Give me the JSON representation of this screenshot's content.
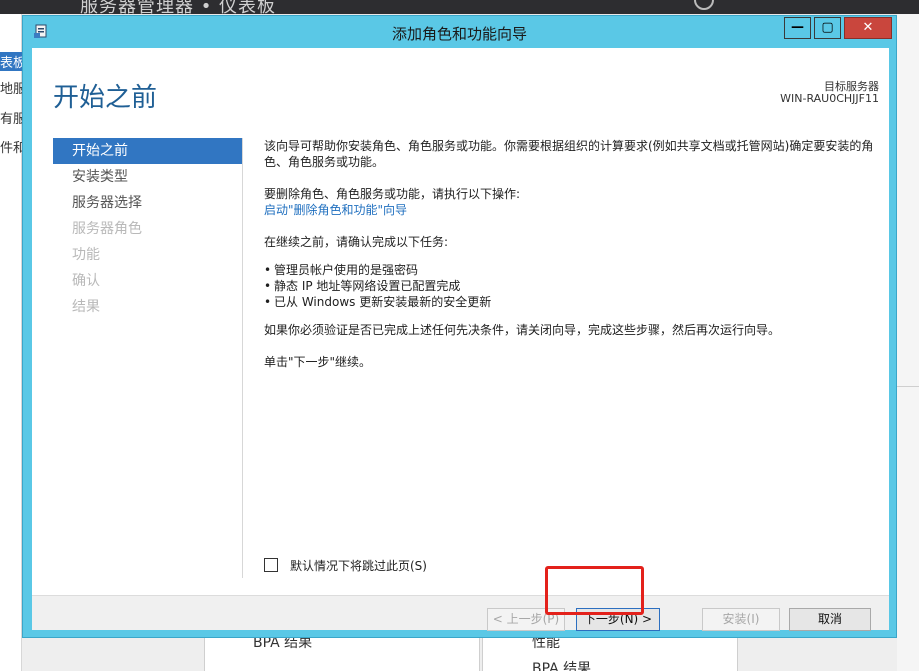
{
  "background": {
    "title_fragment": "服务器管理器 • 仪表板",
    "left_items": [
      "表板",
      "地服",
      "有服",
      "件和"
    ],
    "panels": [
      {
        "text": "BPA 结果"
      },
      {
        "text": "性能"
      },
      {
        "text": "BPA 结果"
      }
    ]
  },
  "window": {
    "title": "添加角色和功能向导",
    "controls": {
      "minimize": "—",
      "maximize": "▢",
      "close": "✕"
    }
  },
  "header": {
    "page_title": "开始之前",
    "dest_label": "目标服务器",
    "dest_server": "WIN-RAU0CHJJF11"
  },
  "nav": {
    "items": [
      {
        "label": "开始之前",
        "state": "active"
      },
      {
        "label": "安装类型",
        "state": "normal"
      },
      {
        "label": "服务器选择",
        "state": "normal"
      },
      {
        "label": "服务器角色",
        "state": "disabled"
      },
      {
        "label": "功能",
        "state": "disabled"
      },
      {
        "label": "确认",
        "state": "disabled"
      },
      {
        "label": "结果",
        "state": "disabled"
      }
    ]
  },
  "content": {
    "intro": "该向导可帮助你安装角色、角色服务或功能。你需要根据组织的计算要求(例如共享文档或托管网站)确定要安装的角色、角色服务或功能。",
    "remove_heading": "要删除角色、角色服务或功能，请执行以下操作:",
    "remove_link": "启动\"删除角色和功能\"向导",
    "confirm_heading": "在继续之前，请确认完成以下任务:",
    "tasks": [
      "管理员帐户使用的是强密码",
      "静态 IP 地址等网络设置已配置完成",
      "已从 Windows 更新安装最新的安全更新"
    ],
    "note": "如果你必须验证是否已完成上述任何先决条件，请关闭向导，完成这些步骤，然后再次运行向导。",
    "continue": "单击\"下一步\"继续。"
  },
  "skip": {
    "label": "默认情况下将跳过此页(S)",
    "checked": false
  },
  "buttons": {
    "prev": "< 上一步(P)",
    "next": "下一步(N) >",
    "install": "安装(I)",
    "cancel": "取消"
  },
  "colors": {
    "titlebar": "#5ac8e6",
    "accent": "#3176c2",
    "page_title": "#1f5f95",
    "highlight": "#e3211b"
  }
}
